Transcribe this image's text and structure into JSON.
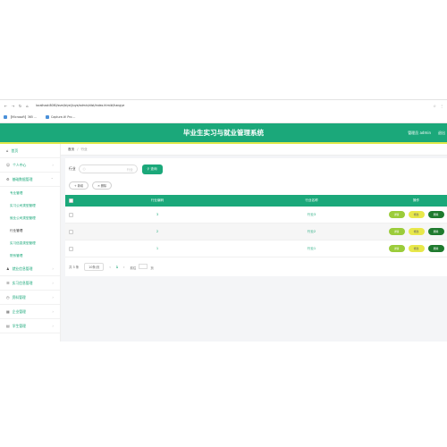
{
  "browser": {
    "url": "localhost:8080/ssm/biye/jiuye/admin/dist/index.html#/hangye",
    "bookmarks": [
      "【Microsoft】365 ...",
      "Capture-It! Pro ..."
    ]
  },
  "header": {
    "title": "毕业生实习与就业管理系统",
    "user_label": "管理员 admin",
    "logout": "退出"
  },
  "sidebar": {
    "home": "首页",
    "personal": "个人中心",
    "basic": "基础数据管理",
    "sub": [
      "专业管理",
      "实习公司类型管理",
      "就业公司类型管理",
      "行业管理",
      "实习信息类型管理",
      "院系管理"
    ],
    "groups": [
      "就业信息管理",
      "实习信息管理",
      "资料管理",
      "企业管理",
      "学生管理"
    ]
  },
  "breadcrumb": {
    "home": "首页",
    "current": "行业"
  },
  "search": {
    "label": "行业",
    "placeholder": "行业",
    "button": "查询"
  },
  "actions": {
    "add": "新增",
    "delete": "删除"
  },
  "table": {
    "headers": [
      "行业编码",
      "行业名称",
      "操作"
    ],
    "rows": [
      {
        "code": "3",
        "name": "行业3"
      },
      {
        "code": "2",
        "name": "行业2"
      },
      {
        "code": "1",
        "name": "行业1"
      }
    ],
    "ops": [
      "详情",
      "修改",
      "删除"
    ]
  },
  "pager": {
    "total": "共 3 条",
    "size": "10条/页",
    "page": "1",
    "goto": "前往",
    "goto_value": "1",
    "unit": "页"
  }
}
